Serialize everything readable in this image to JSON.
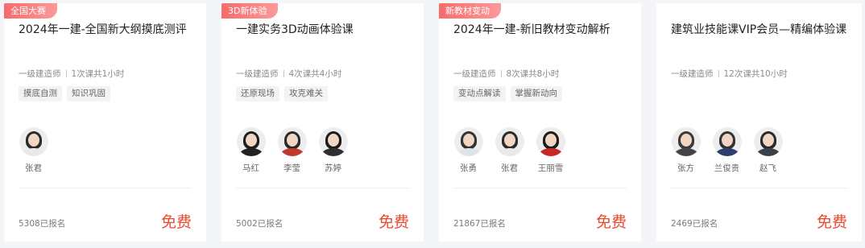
{
  "cards": [
    {
      "badge": "全国大赛",
      "title": "2024年一建-全国新大纲摸底测评",
      "category": "一级建造师",
      "lessons": "1次课共1小时",
      "tags": [
        "摸底自测",
        "知识巩固"
      ],
      "teachers": [
        {
          "name": "张君"
        }
      ],
      "enrolled": "5308已报名",
      "price": "免费"
    },
    {
      "badge": "3D新体验",
      "title": "一建实务3D动画体验课",
      "category": "一级建造师",
      "lessons": "4次课共4小时",
      "tags": [
        "还原现场",
        "攻克难关"
      ],
      "teachers": [
        {
          "name": "马红"
        },
        {
          "name": "李莹"
        },
        {
          "name": "苏婷"
        }
      ],
      "enrolled": "5002已报名",
      "price": "免费"
    },
    {
      "badge": "新教材变动",
      "title": "2024年一建-新旧教材变动解析",
      "category": "一级建造师",
      "lessons": "8次课共8小时",
      "tags": [
        "变动点解读",
        "掌握新动向"
      ],
      "teachers": [
        {
          "name": "张勇"
        },
        {
          "name": "张君"
        },
        {
          "name": "王丽雪"
        }
      ],
      "enrolled": "21867已报名",
      "price": "免费"
    },
    {
      "title": "建筑业技能课VIP会员—精编体验课",
      "category": "一级建造师",
      "lessons": "12次课共10小时",
      "tags": [],
      "teachers": [
        {
          "name": "张方"
        },
        {
          "name": "兰俊贵"
        },
        {
          "name": "赵飞"
        }
      ],
      "enrolled": "2469已报名",
      "price": "免费"
    }
  ]
}
